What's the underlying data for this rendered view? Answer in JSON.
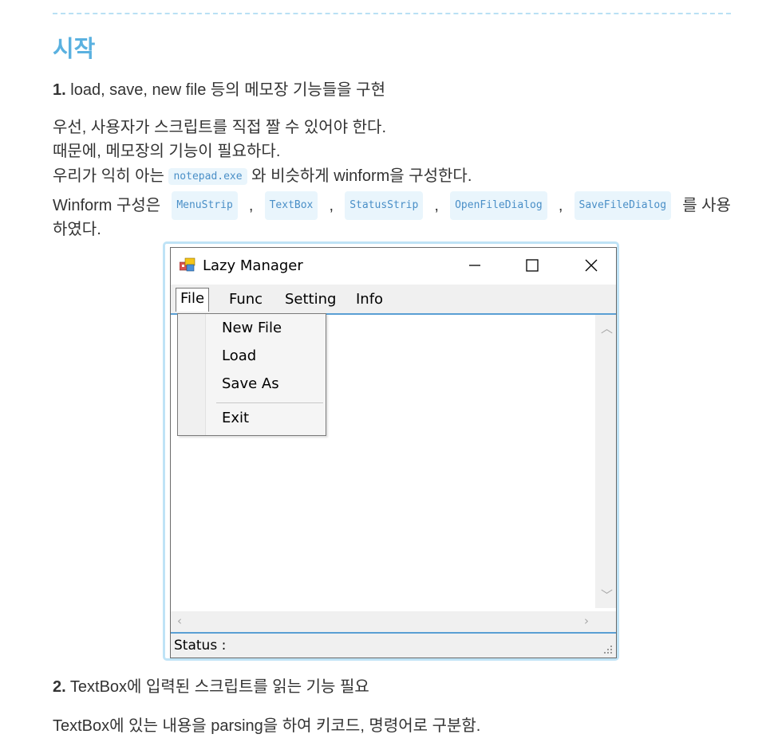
{
  "section": {
    "heading": "시작"
  },
  "step1": {
    "number": "1.",
    "text": "load, save, new file 등의 메모장 기능들을 구현"
  },
  "para1": {
    "line1": "우선, 사용자가 스크립트를 직접 짤 수 있어야 한다.",
    "line2": "때문에, 메모장의 기능이 필요하다.",
    "line3_pre": "우리가 익히 아는",
    "line3_code": "notepad.exe",
    "line3_post": "와 비슷하게 winform을 구성한다.",
    "line4_pre": "Winform 구성은",
    "components": [
      "MenuStrip",
      "TextBox",
      "StatusStrip",
      "OpenFileDialog",
      "SaveFileDialog"
    ],
    "separator": ",",
    "line4_post": "를 사용",
    "line5": "하였다."
  },
  "window": {
    "title": "Lazy Manager",
    "menu": [
      "File",
      "Func",
      "Setting",
      "Info"
    ],
    "file_menu": [
      "New File",
      "Load",
      "Save As",
      "Exit"
    ],
    "status": "Status :"
  },
  "step2": {
    "number": "2.",
    "text": "TextBox에 입력된 스크립트를 읽는 기능 필요"
  },
  "para2": {
    "line1": "TextBox에 있는 내용을 parsing을 하여 키코드, 명령어로 구분함."
  },
  "colors": {
    "heading": "#5ab1e0",
    "code_text": "#4a8fc7",
    "code_bg": "#e9f5fc",
    "frame": "#bfe3f6"
  }
}
